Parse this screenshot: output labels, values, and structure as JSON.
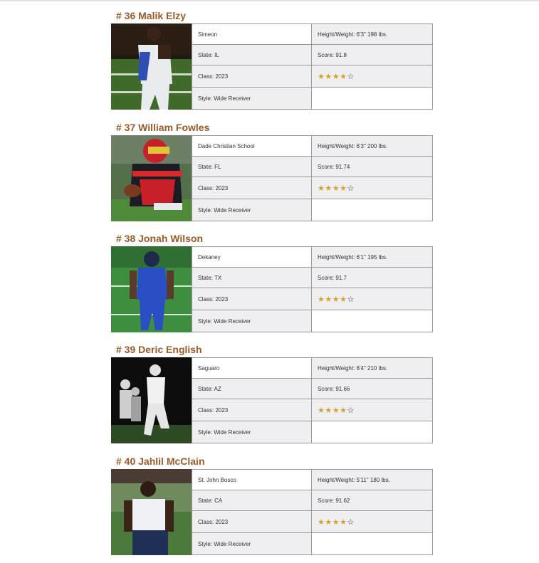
{
  "players": [
    {
      "rank": "# 36 Malik Elzy",
      "school": "Simeon",
      "height_weight": "Height/Weight: 6'3\"  198 lbs.",
      "state": "State: IL",
      "score": "Score: 91.8",
      "class": "Class: 2023",
      "stars": 4,
      "stars_max": 5,
      "style": "Style: Wide Receiver"
    },
    {
      "rank": "# 37 William Fowles",
      "school": "Dade Christian School",
      "height_weight": "Height/Weight: 6'3\"  200 lbs.",
      "state": "State: FL",
      "score": "Score: 91.74",
      "class": "Class: 2023",
      "stars": 4,
      "stars_max": 5,
      "style": "Style: Wide Receiver"
    },
    {
      "rank": "# 38 Jonah Wilson",
      "school": "Dekaney",
      "height_weight": "Height/Weight: 6'1\"  195 lbs.",
      "state": "State: TX",
      "score": "Score: 91.7",
      "class": "Class: 2023",
      "stars": 4,
      "stars_max": 5,
      "style": "Style: Wide Receiver"
    },
    {
      "rank": "# 39 Deric English",
      "school": "Saguaro",
      "height_weight": "Height/Weight: 6'4\"  210 lbs.",
      "state": "State: AZ",
      "score": "Score: 91.66",
      "class": "Class: 2023",
      "stars": 4,
      "stars_max": 5,
      "style": "Style: Wide Receiver"
    },
    {
      "rank": "# 40 Jahlil McClain",
      "school": "St. John Bosco",
      "height_weight": "Height/Weight: 5'11\"  180 lbs.",
      "state": "State: CA",
      "score": "Score: 91.62",
      "class": "Class: 2023",
      "stars": 4,
      "stars_max": 5,
      "style": "Style: Wide Receiver"
    }
  ],
  "colors": {
    "title": "#9a5b2a",
    "star_on": "#d4a52a",
    "star_off": "#333333",
    "cell_gray": "#efeff1",
    "border": "#9a9a9a"
  }
}
